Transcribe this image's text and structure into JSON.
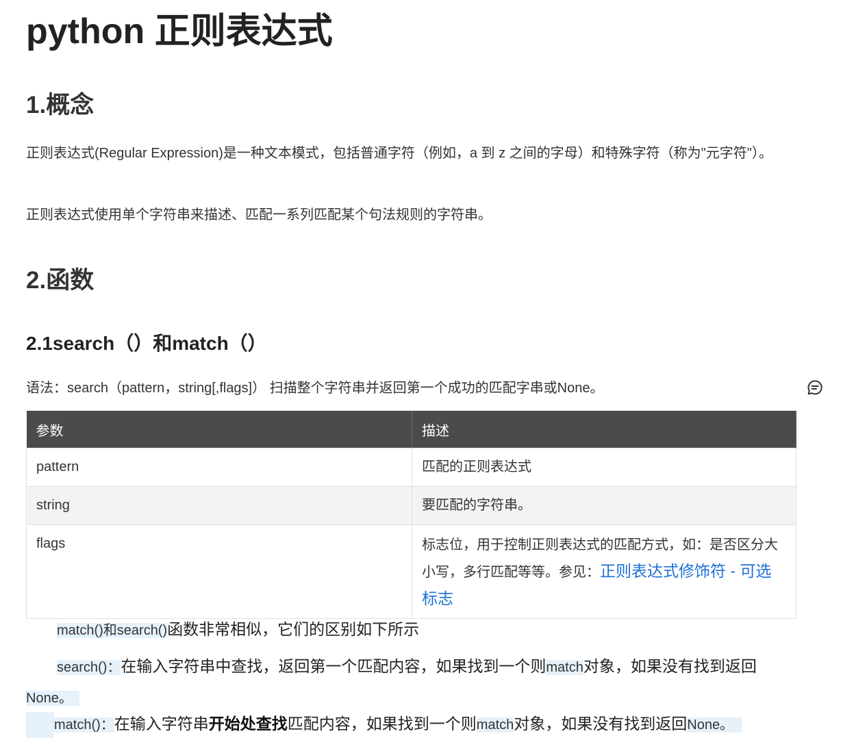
{
  "title": "python 正则表达式",
  "section1": {
    "heading": "1.概念",
    "para1": "正则表达式(Regular Expression)是一种文本模式，包括普通字符（例如，a 到 z 之间的字母）和特殊字符（称为\"元字符\"）。",
    "para2": "正则表达式使用单个字符串来描述、匹配一系列匹配某个句法规则的字符串。"
  },
  "section2": {
    "heading": "2.函数",
    "sub1": {
      "heading": "2.1search（）和match（）",
      "syntax": "语法：search（pattern，string[,flags]） 扫描整个字符串并返回第一个成功的匹配字串或None。",
      "table": {
        "headers": [
          "参数",
          "描述"
        ],
        "rows": [
          {
            "param": "pattern",
            "desc": "匹配的正则表达式"
          },
          {
            "param": "string",
            "desc": "要匹配的字符串。"
          },
          {
            "param": "flags",
            "desc": "标志位，用于控制正则表达式的匹配方式，如：是否区分大小写，多行匹配等等。参见：",
            "link": "正则表达式修饰符 - 可选标志"
          }
        ]
      },
      "notes": {
        "n1_code": "match()和search()",
        "n1_text": "函数非常相似，它们的区别如下所示",
        "n2_code": "search()：",
        "n2_text_a": "在输入字符串中查找，返回第一个匹配内容，如果找到一个则",
        "n2_code_b": "match",
        "n2_text_b": "对象，如果没有找到返回",
        "n2_code_c": "None。",
        "n3_code": "match()：",
        "n3_text_a": "在输入字符串",
        "n3_bold": "开始处查找",
        "n3_text_b": "匹配内容，如果找到一个则",
        "n3_code_b": "match",
        "n3_text_c": "对象，如果没有找到返回",
        "n3_code_c": "None。"
      }
    }
  },
  "icons": {
    "comment": "comment-icon"
  }
}
